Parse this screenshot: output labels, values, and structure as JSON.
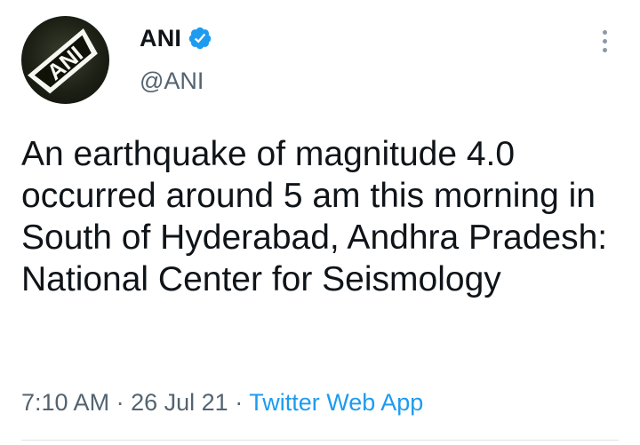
{
  "tweet": {
    "author": {
      "display_name": "ANI",
      "handle": "@ANI",
      "verified": true,
      "avatar_logo_text": "ANI"
    },
    "text": "An earthquake of magnitude 4.0 occurred around 5 am this morning in South of Hyderabad, Andhra Pradesh: National Center for Seismology",
    "time": "7:10 AM",
    "separator": "·",
    "date": "26 Jul 21",
    "source": "Twitter Web App"
  },
  "icons": {
    "verified": "verified-badge-icon",
    "more": "more-vertical-icon"
  },
  "colors": {
    "text_primary": "#0f1419",
    "text_secondary": "#536471",
    "link": "#1d9bf0",
    "verified_badge": "#1d9bf0"
  }
}
